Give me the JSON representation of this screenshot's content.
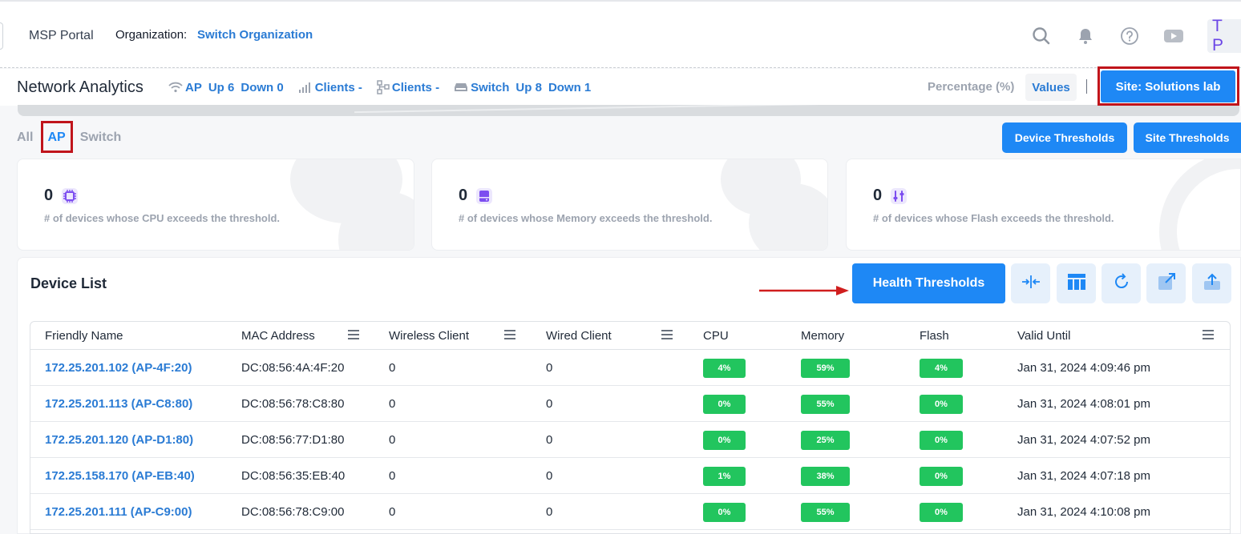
{
  "header": {
    "brand": "MSP Portal",
    "org_label": "Organization:",
    "org_link": "Switch Organization",
    "avatar": "T P"
  },
  "titlebar": {
    "title": "Network Analytics",
    "ap": {
      "label": "AP",
      "up": "Up 6",
      "down": "Down 0"
    },
    "wireless_clients": "Clients -",
    "wired_clients": "Clients -",
    "switch": {
      "label": "Switch",
      "up": "Up 8",
      "down": "Down 1"
    },
    "percentage_label": "Percentage (%)",
    "values_label": "Values",
    "site_button": "Site: Solutions lab"
  },
  "filters": {
    "all": "All",
    "ap": "AP",
    "switch": "Switch"
  },
  "threshold_buttons": {
    "device": "Device Thresholds",
    "site": "Site Thresholds"
  },
  "cards": [
    {
      "count": "0",
      "desc": "# of devices whose CPU exceeds the threshold.",
      "icon": "cpu-icon"
    },
    {
      "count": "0",
      "desc": "# of devices whose Memory exceeds the threshold.",
      "icon": "memory-icon"
    },
    {
      "count": "0",
      "desc": "# of devices whose Flash exceeds the threshold.",
      "icon": "flash-icon"
    }
  ],
  "device_list": {
    "title": "Device List",
    "health_button": "Health Thresholds",
    "columns": [
      "Friendly Name",
      "MAC Address",
      "Wireless Client",
      "Wired Client",
      "CPU",
      "Memory",
      "Flash",
      "Valid Until"
    ],
    "rows": [
      {
        "name": "172.25.201.102 (AP-4F:20)",
        "mac": "DC:08:56:4A:4F:20",
        "wireless": "0",
        "wired": "0",
        "cpu": "4%",
        "memory": "59%",
        "flash": "4%",
        "valid": "Jan 31, 2024 4:09:46 pm"
      },
      {
        "name": "172.25.201.113 (AP-C8:80)",
        "mac": "DC:08:56:78:C8:80",
        "wireless": "0",
        "wired": "0",
        "cpu": "0%",
        "memory": "55%",
        "flash": "0%",
        "valid": "Jan 31, 2024 4:08:01 pm"
      },
      {
        "name": "172.25.201.120 (AP-D1:80)",
        "mac": "DC:08:56:77:D1:80",
        "wireless": "0",
        "wired": "0",
        "cpu": "0%",
        "memory": "25%",
        "flash": "0%",
        "valid": "Jan 31, 2024 4:07:52 pm"
      },
      {
        "name": "172.25.158.170 (AP-EB:40)",
        "mac": "DC:08:56:35:EB:40",
        "wireless": "0",
        "wired": "0",
        "cpu": "1%",
        "memory": "38%",
        "flash": "0%",
        "valid": "Jan 31, 2024 4:07:18 pm"
      },
      {
        "name": "172.25.201.111 (AP-C9:00)",
        "mac": "DC:08:56:78:C9:00",
        "wireless": "0",
        "wired": "0",
        "cpu": "0%",
        "memory": "55%",
        "flash": "0%",
        "valid": "Jan 31, 2024 4:10:08 pm"
      }
    ]
  },
  "colors": {
    "accent": "#1e88f5",
    "link": "#2a7bd4",
    "success": "#22c55e",
    "highlight": "#c0141b",
    "avatar": "#6b46e6"
  }
}
